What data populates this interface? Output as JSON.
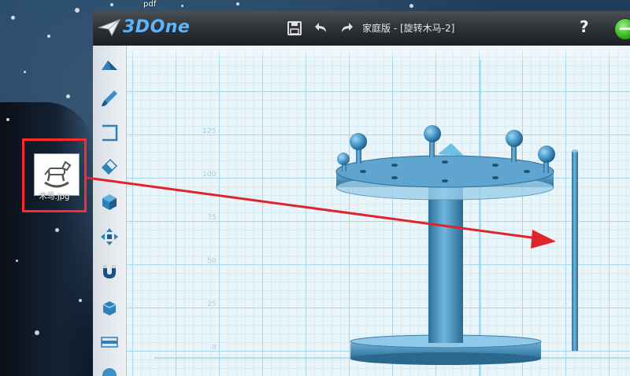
{
  "desktop": {
    "label_top": "pdf",
    "file_icon_name": "木马.jpg"
  },
  "app": {
    "logo_text": "3DOne",
    "title": "家庭版 - [旋转木马-2]",
    "help_label": "?"
  },
  "toolbar": {
    "items": [
      "sketch-tool-icon",
      "brush-tool-icon",
      "frame-tool-icon",
      "eraser-tool-icon",
      "cube-tool-icon",
      "move-tool-icon",
      "magnet-tool-icon",
      "combine-tool-icon",
      "layer-tool-icon",
      "sphere-tool-icon"
    ]
  },
  "axis": {
    "labels": [
      "125",
      "100",
      "75",
      "50",
      "25",
      "0"
    ]
  },
  "colors": {
    "model": "#4f9cc8",
    "arrow": "#e0242c",
    "highlight_box": "#ff2a2a",
    "logo": "#5ab4ff"
  }
}
